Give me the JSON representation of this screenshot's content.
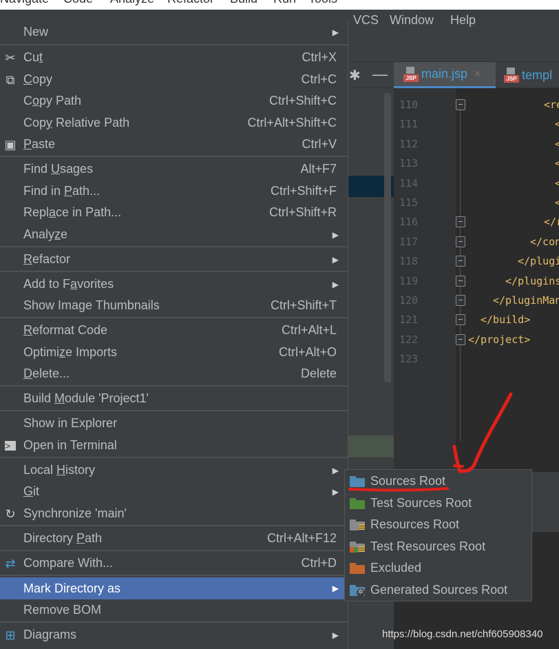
{
  "menubar": {
    "items": [
      {
        "label": "Navigate"
      },
      {
        "label": "Code"
      },
      {
        "label": "Analyze"
      },
      {
        "label": "Refactor"
      },
      {
        "label": "Build"
      },
      {
        "label": "Run"
      },
      {
        "label": "Tools"
      },
      {
        "label": "VCS"
      },
      {
        "label": "Window"
      },
      {
        "label": "Help"
      }
    ]
  },
  "editor": {
    "tabs": [
      {
        "label": "main.jsp",
        "close": "×",
        "icon": "jsp-file-icon"
      },
      {
        "label": "templ",
        "icon": "jsp-file-icon"
      }
    ],
    "line_numbers": [
      "110",
      "111",
      "112",
      "113",
      "114",
      "115",
      "116",
      "117",
      "118",
      "119",
      "120",
      "121",
      "122",
      "123"
    ],
    "code_lines": [
      "<re",
      "<",
      "<",
      "<",
      "<",
      "<",
      "</r",
      "</con",
      "</plugi",
      "</plugins",
      "</pluginMan",
      "</build>",
      "</project>",
      ""
    ]
  },
  "context_menu": {
    "items": [
      {
        "label": "New",
        "shortcut": "",
        "submenu": true,
        "icon": ""
      },
      {
        "label": "Cut",
        "shortcut": "Ctrl+X",
        "icon": "scissors-icon"
      },
      {
        "label": "Copy",
        "shortcut": "Ctrl+C",
        "icon": "copy-icon"
      },
      {
        "label": "Copy Path",
        "shortcut": "Ctrl+Shift+C",
        "icon": ""
      },
      {
        "label": "Copy Relative Path",
        "shortcut": "Ctrl+Alt+Shift+C",
        "icon": ""
      },
      {
        "label": "Paste",
        "shortcut": "Ctrl+V",
        "icon": "clipboard-icon"
      },
      {
        "label": "Find Usages",
        "shortcut": "Alt+F7",
        "icon": ""
      },
      {
        "label": "Find in Path...",
        "shortcut": "Ctrl+Shift+F",
        "icon": ""
      },
      {
        "label": "Replace in Path...",
        "shortcut": "Ctrl+Shift+R",
        "icon": ""
      },
      {
        "label": "Analyze",
        "shortcut": "",
        "submenu": true,
        "icon": ""
      },
      {
        "label": "Refactor",
        "shortcut": "",
        "submenu": true,
        "icon": ""
      },
      {
        "label": "Add to Favorites",
        "shortcut": "",
        "submenu": true,
        "icon": ""
      },
      {
        "label": "Show Image Thumbnails",
        "shortcut": "Ctrl+Shift+T",
        "icon": ""
      },
      {
        "label": "Reformat Code",
        "shortcut": "Ctrl+Alt+L",
        "icon": ""
      },
      {
        "label": "Optimize Imports",
        "shortcut": "Ctrl+Alt+O",
        "icon": ""
      },
      {
        "label": "Delete...",
        "shortcut": "Delete",
        "icon": ""
      },
      {
        "label": "Build Module 'Project1'",
        "shortcut": "",
        "icon": ""
      },
      {
        "label": "Show in Explorer",
        "shortcut": "",
        "icon": ""
      },
      {
        "label": "Open in Terminal",
        "shortcut": "",
        "icon": "terminal-icon"
      },
      {
        "label": "Local History",
        "shortcut": "",
        "submenu": true,
        "icon": ""
      },
      {
        "label": "Git",
        "shortcut": "",
        "submenu": true,
        "icon": ""
      },
      {
        "label": "Synchronize 'main'",
        "shortcut": "",
        "icon": "sync-icon"
      },
      {
        "label": "Directory Path",
        "shortcut": "Ctrl+Alt+F12",
        "icon": ""
      },
      {
        "label": "Compare With...",
        "shortcut": "Ctrl+D",
        "icon": "compare-icon"
      },
      {
        "label": "Mark Directory as",
        "shortcut": "",
        "submenu": true,
        "highlighted": true,
        "icon": ""
      },
      {
        "label": "Remove BOM",
        "shortcut": "",
        "icon": ""
      },
      {
        "label": "Diagrams",
        "shortcut": "",
        "submenu": true,
        "icon": "diagram-icon"
      }
    ]
  },
  "submenu": {
    "items": [
      {
        "label": "Sources Root",
        "color": "#4e8ab5",
        "icon": "source-folder-icon"
      },
      {
        "label": "Test Sources Root",
        "color": "#4f8a3a",
        "icon": "test-folder-icon"
      },
      {
        "label": "Resources Root",
        "color": "#8a8a8a",
        "icon": "resources-folder-icon"
      },
      {
        "label": "Test Resources Root",
        "color": "#8a8a8a",
        "icon": "test-resources-folder-icon"
      },
      {
        "label": "Excluded",
        "color": "#c2662e",
        "icon": "excluded-folder-icon"
      },
      {
        "label": "Generated Sources Root",
        "color": "#4e8ab5",
        "icon": "generated-folder-icon"
      }
    ]
  },
  "annotation_color": "#e0201b",
  "highlight_color": "#4b6eaf",
  "watermark": "https://blog.csdn.net/chf605908340"
}
